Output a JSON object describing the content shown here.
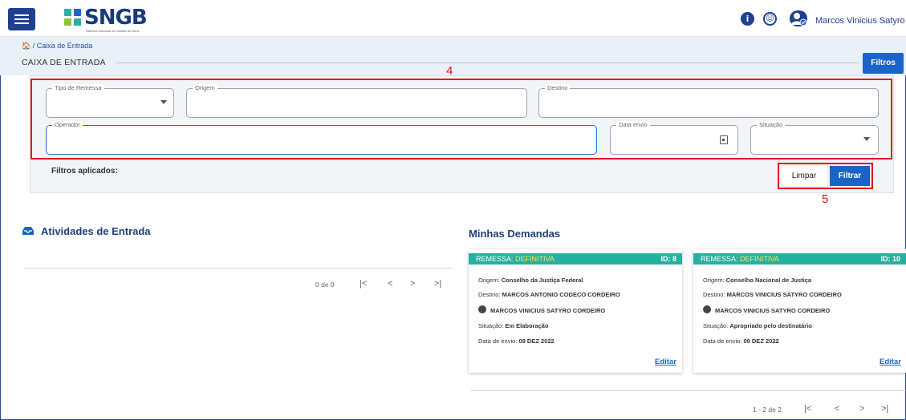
{
  "header": {
    "logo_text": "SNGB",
    "logo_subtitle": "Sistema Nacional de Gestão de Bens",
    "user_name": "Marcos Vinicius Satyro C.",
    "icons": [
      "menu-icon",
      "info-icon",
      "accessibility-icon",
      "user-check-icon"
    ]
  },
  "breadcrumb": {
    "home_icon": "home-icon",
    "text": "/ Caixa de Entrada"
  },
  "page": {
    "title": "CAIXA DE ENTRADA",
    "filters_button": "Filtros"
  },
  "filters": {
    "tipo_remessa": {
      "label": "Tipo de Remessa",
      "value": ""
    },
    "origem": {
      "label": "Origem",
      "value": ""
    },
    "destino": {
      "label": "Destino",
      "value": ""
    },
    "operador": {
      "label": "Operador",
      "value": ""
    },
    "data_envio": {
      "label": "Data envio",
      "value": ""
    },
    "situacao": {
      "label": "Situação",
      "value": ""
    },
    "applied_label": "Filtros aplicados:",
    "clear_button": "Limpar",
    "filter_button": "Filtrar"
  },
  "annotations": {
    "filters_box": "4",
    "buttons_box": "5"
  },
  "atividades": {
    "title": "Atividades de Entrada",
    "pager": "0 de 0"
  },
  "demandas": {
    "title": "Minhas Demandas",
    "pager": "1 - 2 de 2",
    "cards": [
      {
        "head_label": "REMESSA:",
        "head_type": "DEFINITIVA",
        "id": "ID: 8",
        "origem_label": "Origem:",
        "origem": "Conselho da Justiça Federal",
        "destino_label": "Destino:",
        "destino": "MARCOS ANTONIO CODECO CORDEIRO",
        "operador": "MARCOS VINICIUS SATYRO CORDEIRO",
        "situacao_label": "Situação:",
        "situacao": "Em Elaboração",
        "data_label": "Data de envio:",
        "data": "09 DEZ 2022",
        "edit": "Editar"
      },
      {
        "head_label": "REMESSA:",
        "head_type": "DEFINITIVA",
        "id": "ID: 10",
        "origem_label": "Origem:",
        "origem": "Conselho Nacional de Justiça",
        "destino_label": "Destino:",
        "destino": "MARCOS VINICIUS SATYRO CORDEIRO",
        "operador": "MARCOS VINICIUS SATYRO CORDEIRO",
        "situacao_label": "Situação:",
        "situacao": "Apropriado pelo destinatário",
        "data_label": "Data de envio:",
        "data": "09 DEZ 2022",
        "edit": "Editar"
      }
    ]
  },
  "colors": {
    "primary": "#1a64c8",
    "navy": "#1f3f8f",
    "card_header": "#27b0a0",
    "highlight": "#e3131b"
  }
}
